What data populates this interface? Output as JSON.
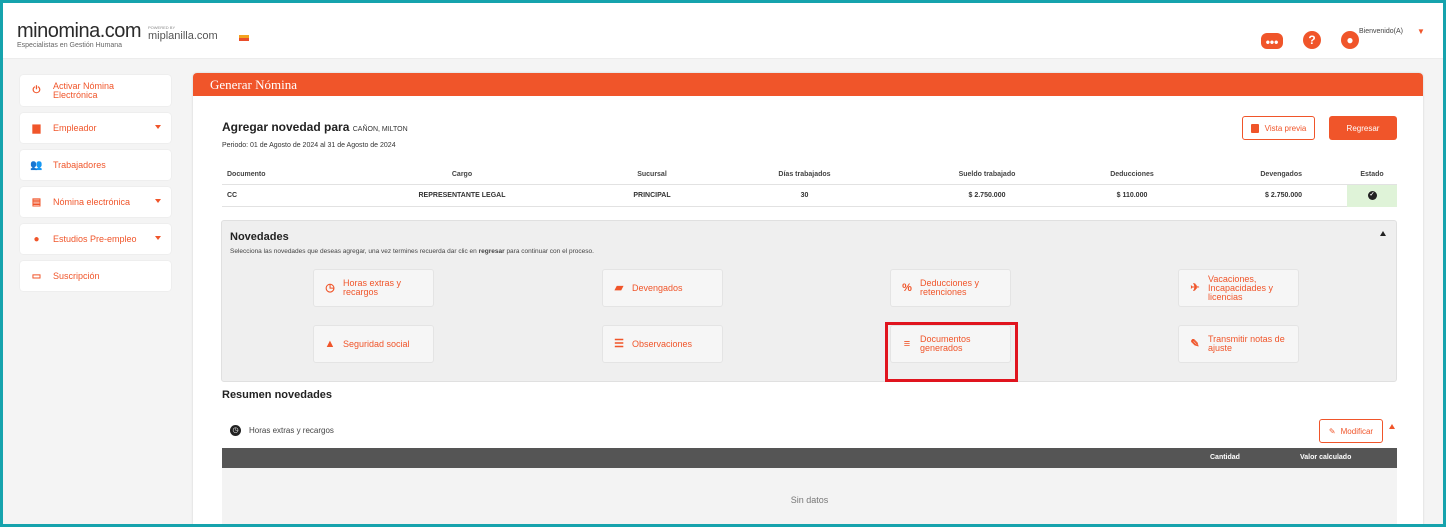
{
  "header": {
    "logo_name": "minomina.com",
    "logo_tagline": "Especialistas en Gestión Humana",
    "partner_small": "POWERED BY",
    "partner_name": "miplanilla.com",
    "welcome": "Bienvenido(A)",
    "icons": [
      "chat-icon",
      "help-icon",
      "user-icon"
    ],
    "accent_color": "#f0552a"
  },
  "sidebar": {
    "items": [
      {
        "label": "Activar Nómina Electrónica",
        "icon": "power-icon",
        "has_caret": false
      },
      {
        "label": "Empleador",
        "icon": "building-icon",
        "has_caret": true
      },
      {
        "label": "Trabajadores",
        "icon": "users-icon",
        "has_caret": false
      },
      {
        "label": "Nómina electrónica",
        "icon": "document-icon",
        "has_caret": true
      },
      {
        "label": "Estudios Pre-empleo",
        "icon": "person-icon",
        "has_caret": true
      },
      {
        "label": "Suscripción",
        "icon": "card-icon",
        "has_caret": false
      }
    ]
  },
  "main": {
    "title": "Generar Nómina",
    "add_title": "Agregar novedad para",
    "employee": "CAÑON, MILTON",
    "period": "Periodo: 01 de Agosto de 2024 al 31 de Agosto de 2024",
    "preview_label": "Vista previa",
    "back_label": "Regresar",
    "table": {
      "headers": [
        "Documento",
        "Cargo",
        "Sucursal",
        "Días trabajados",
        "Sueldo trabajado",
        "Deducciones",
        "Devengados",
        "Estado"
      ],
      "row": [
        "CC",
        "REPRESENTANTE LEGAL",
        "PRINCIPAL",
        "30",
        "$ 2.750.000",
        "$ 110.000",
        "$ 2.750.000"
      ]
    }
  },
  "novedades": {
    "title": "Novedades",
    "desc_before": "Selecciona las novedades que deseas agregar, una vez termines recuerda dar clic en ",
    "desc_bold": "regresar",
    "desc_after": " para continuar con el proceso.",
    "cards": [
      {
        "label": "Horas extras y recargos",
        "icon": "clock-icon"
      },
      {
        "label": "Devengados",
        "icon": "money-icon"
      },
      {
        "label": "Deducciones y retenciones",
        "icon": "percent-icon"
      },
      {
        "label": "Vacaciones, Incapacidades y licencias",
        "icon": "plane-icon"
      },
      {
        "label": "Seguridad social",
        "icon": "helmet-icon"
      },
      {
        "label": "Observaciones",
        "icon": "notes-icon"
      },
      {
        "label": "Documentos generados",
        "icon": "list-icon"
      },
      {
        "label": "Transmitir notas de ajuste",
        "icon": "edit-icon"
      }
    ]
  },
  "resumen": {
    "title": "Resumen novedades",
    "section": "Horas extras y recargos",
    "modify_label": "Modificar",
    "columns": [
      "Cantidad",
      "Valor calculado"
    ],
    "empty": "Sin datos"
  }
}
